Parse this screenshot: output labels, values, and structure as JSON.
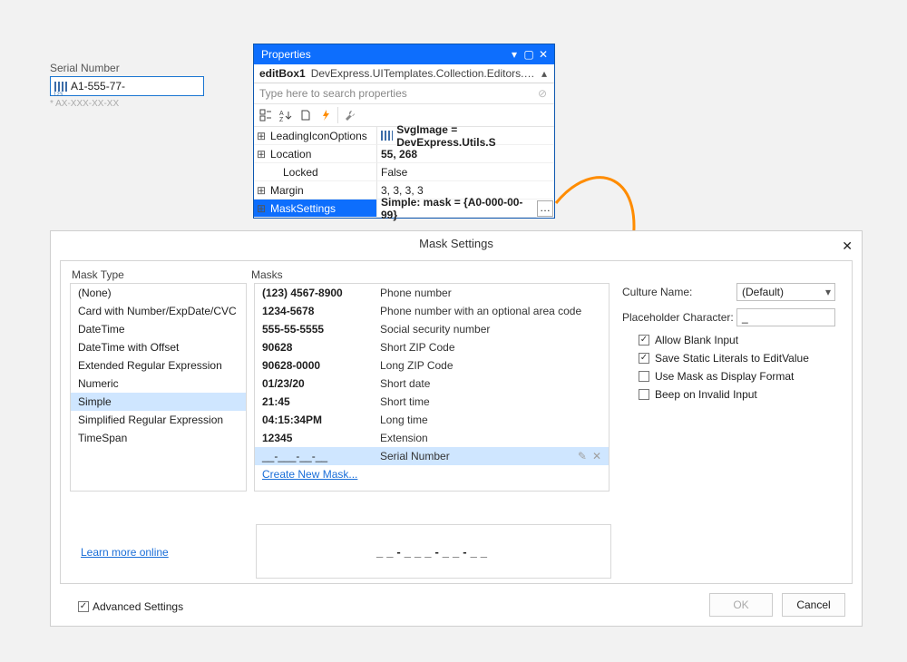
{
  "serial_field": {
    "label": "Serial Number",
    "value": "A1-555-77-",
    "helper": "* AX-XXX-XX-XX"
  },
  "props": {
    "title": "Properties",
    "selector_name": "editBox1",
    "selector_class": "DevExpress.UITemplates.Collection.Editors.EditBox",
    "search_placeholder": "Type here to search properties",
    "rows": [
      {
        "key": "LeadingIconOptions",
        "value": "SvgImage = DevExpress.Utils.S",
        "expandable": true,
        "bold": true,
        "icon": true
      },
      {
        "key": "Location",
        "value": "55, 268",
        "expandable": true,
        "bold": true
      },
      {
        "key": "Locked",
        "value": "False",
        "expandable": false,
        "bold": false
      },
      {
        "key": "Margin",
        "value": "3, 3, 3, 3",
        "expandable": true,
        "bold": false
      },
      {
        "key": "MaskSettings",
        "value": "Simple: mask = {A0-000-00-99}",
        "expandable": true,
        "bold": true,
        "selected": true,
        "dots": true
      }
    ]
  },
  "dialog": {
    "title": "Mask Settings",
    "head_type": "Mask Type",
    "head_masks": "Masks",
    "mask_types": [
      "(None)",
      "Card with Number/ExpDate/CVC",
      "DateTime",
      "DateTime with Offset",
      "Extended Regular Expression",
      "Numeric",
      "Simple",
      "Simplified Regular Expression",
      "TimeSpan"
    ],
    "mask_type_selected": "Simple",
    "masks": [
      {
        "v": "(123) 4567-8900",
        "d": "Phone number"
      },
      {
        "v": "1234-5678",
        "d": "Phone number with an optional area code"
      },
      {
        "v": "555-55-5555",
        "d": "Social security number"
      },
      {
        "v": "90628",
        "d": "Short ZIP Code"
      },
      {
        "v": "90628-0000",
        "d": "Long ZIP Code"
      },
      {
        "v": "01/23/20",
        "d": "Short date"
      },
      {
        "v": "21:45",
        "d": "Short time"
      },
      {
        "v": "04:15:34PM",
        "d": "Long time"
      },
      {
        "v": "12345",
        "d": "Extension"
      },
      {
        "v": "__-___-__-__",
        "d": "Serial Number",
        "selected": true
      }
    ],
    "create_link": "Create New Mask...",
    "learn_link": "Learn more online",
    "preview": "__-___-__-__",
    "advanced_label": "Advanced Settings",
    "ok_label": "OK",
    "cancel_label": "Cancel",
    "opts": {
      "culture_label": "Culture Name:",
      "culture_value": "(Default)",
      "placeholder_label": "Placeholder Character:",
      "placeholder_value": "_",
      "allow_blank": "Allow Blank Input",
      "save_literals": "Save Static Literals to EditValue",
      "use_mask_display": "Use Mask as Display Format",
      "beep_invalid": "Beep on Invalid Input"
    }
  }
}
